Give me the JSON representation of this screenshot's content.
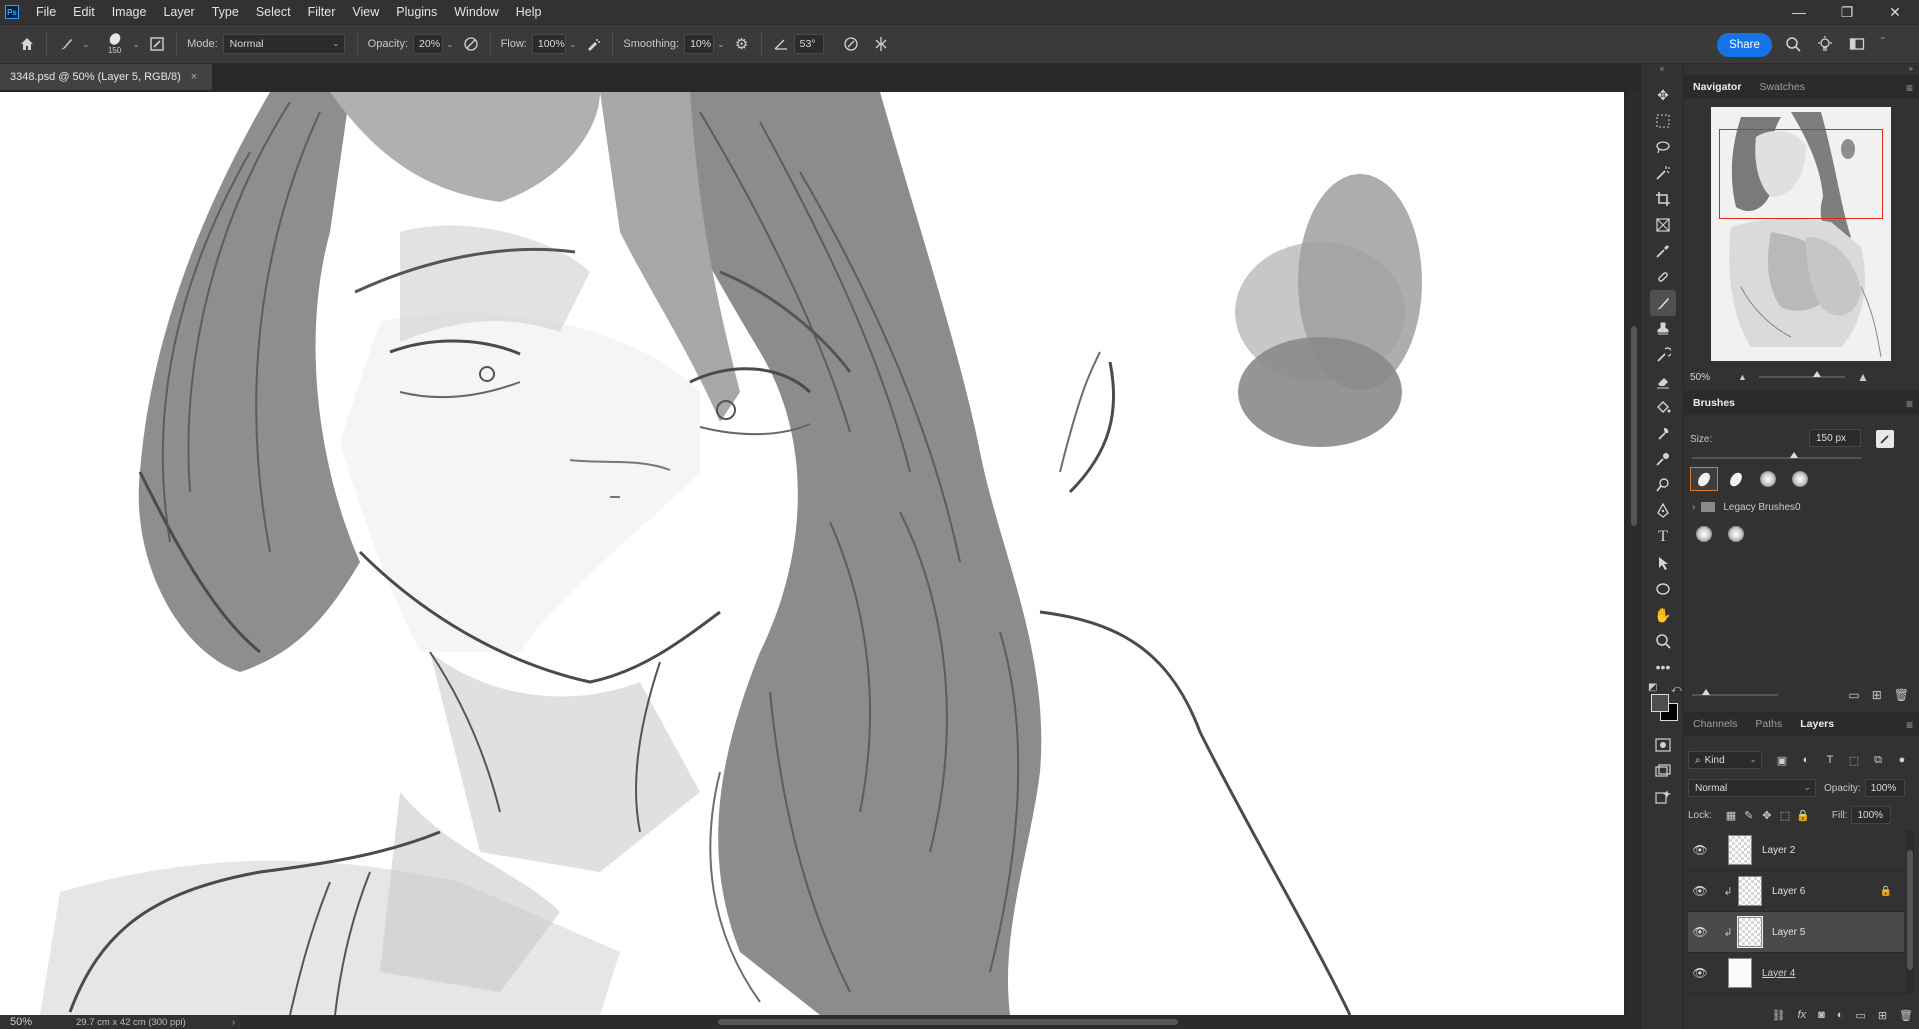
{
  "app": {
    "logo": "Ps"
  },
  "menu": [
    "File",
    "Edit",
    "Image",
    "Layer",
    "Type",
    "Select",
    "Filter",
    "View",
    "Plugins",
    "Window",
    "Help"
  ],
  "window_controls": {
    "minimize": "—",
    "restore": "❐",
    "close": "✕"
  },
  "options": {
    "brush_size": "150",
    "mode_label": "Mode:",
    "mode_value": "Normal",
    "opacity_label": "Opacity:",
    "opacity_value": "20%",
    "flow_label": "Flow:",
    "flow_value": "100%",
    "smoothing_label": "Smoothing:",
    "smoothing_value": "10%",
    "angle_value": "53°",
    "share_label": "Share"
  },
  "document": {
    "tab_title": "3348.psd @ 50% (Layer 5, RGB/8)",
    "close": "×"
  },
  "status": {
    "zoom": "50%",
    "doc_info": "29.7 cm x 42 cm (300 ppi)"
  },
  "navigator": {
    "tabs": [
      "Navigator",
      "Swatches"
    ],
    "zoom": "50%"
  },
  "brushes": {
    "title": "Brushes",
    "size_label": "Size:",
    "size_value": "150 px",
    "size_fraction": 0.6,
    "legacy_folder": "Legacy Brushes0"
  },
  "layers_panel": {
    "tabs": [
      "Channels",
      "Paths",
      "Layers"
    ],
    "kind_label": "Kind",
    "blend_mode": "Normal",
    "opacity_label": "Opacity:",
    "opacity_value": "100%",
    "lock_label": "Lock:",
    "fill_label": "Fill:",
    "fill_value": "100%",
    "layers": [
      {
        "name": "Layer 2",
        "clipped": false,
        "locked": false,
        "selected": false
      },
      {
        "name": "Layer 6",
        "clipped": true,
        "locked": true,
        "selected": false
      },
      {
        "name": "Layer 5",
        "clipped": true,
        "locked": false,
        "selected": true
      },
      {
        "name": "Layer 4",
        "clipped": false,
        "locked": false,
        "selected": false
      }
    ]
  },
  "colors": {
    "accent": "#1473e6",
    "foreground": "#4d4d4d",
    "background": "#000000",
    "navigator_frame": "#e1261c"
  }
}
